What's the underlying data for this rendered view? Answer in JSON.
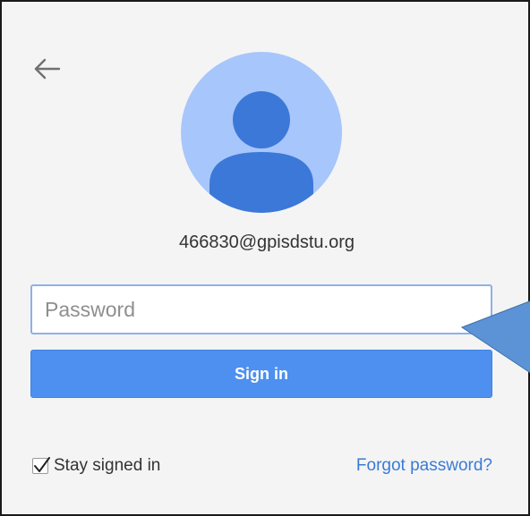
{
  "account": {
    "email": "466830@gpisdstu.org"
  },
  "password_field": {
    "placeholder": "Password",
    "value": ""
  },
  "signin_button": {
    "label": "Sign in"
  },
  "stay_signed_in": {
    "label": "Stay signed in",
    "checked": true
  },
  "forgot_password": {
    "label": "Forgot password?"
  },
  "icons": {
    "back": "back-arrow-icon",
    "avatar": "person-avatar-icon",
    "checkbox": "checkmark-icon"
  },
  "colors": {
    "accent": "#4d90f0",
    "link": "#3a7bd5",
    "avatar_background": "#a7c6fb",
    "avatar_figure": "#3c78d8",
    "card_background": "#f4f4f4",
    "callout_fill": "#5b93d6"
  }
}
